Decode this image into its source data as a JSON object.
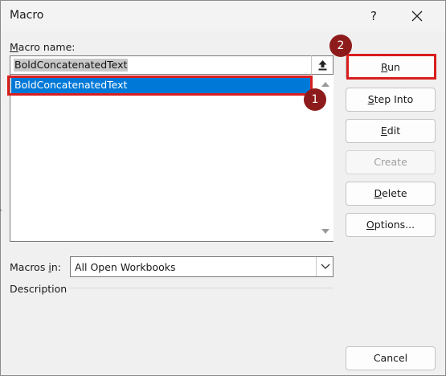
{
  "window": {
    "title": "Macro",
    "help_label": "?",
    "close_icon": "close-icon"
  },
  "macro_name": {
    "label_ul": "M",
    "label_rest": "acro name:",
    "value": "BoldConcatenatedText"
  },
  "macro_list": {
    "items": [
      "BoldConcatenatedText"
    ],
    "selected_index": 0
  },
  "buttons": {
    "run": {
      "ul": "R",
      "rest": "un"
    },
    "step_into": {
      "ul": "S",
      "rest": "tep Into"
    },
    "edit": {
      "ul": "E",
      "rest": "dit"
    },
    "create": {
      "label": "Create",
      "disabled": true
    },
    "delete": {
      "ul": "D",
      "rest": "elete"
    },
    "options": {
      "ul": "O",
      "rest": "ptions..."
    },
    "cancel": {
      "label": "Cancel"
    }
  },
  "macros_in": {
    "label_pre": "Macros ",
    "label_ul": "i",
    "label_post": "n:",
    "selected": "All Open Workbooks"
  },
  "description": {
    "label": "Description"
  },
  "annotations": {
    "step1": "1",
    "step2": "2",
    "highlight_color": "#d91e1e",
    "badge_color": "#8e1b1b"
  },
  "colors": {
    "selection": "#0078d7",
    "dialog_bg": "#f0f0f0"
  }
}
